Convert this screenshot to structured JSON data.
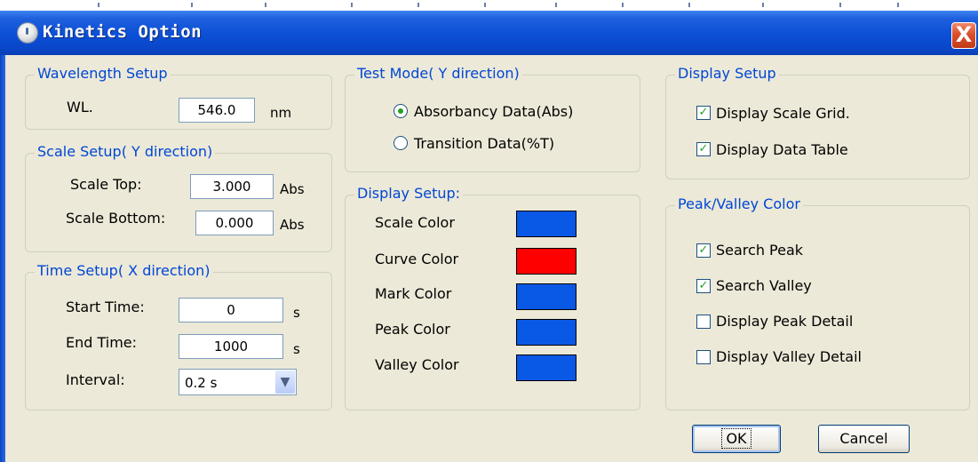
{
  "window": {
    "title": "Kinetics Option",
    "close_label": "X"
  },
  "wavelength_setup": {
    "legend": "Wavelength Setup",
    "label": "WL.",
    "value": "546.0",
    "unit": "nm"
  },
  "scale_setup": {
    "legend": "Scale Setup( Y direction)",
    "top_label": "Scale Top:",
    "top_value": "3.000",
    "top_unit": "Abs",
    "bottom_label": "Scale Bottom:",
    "bottom_value": "0.000",
    "bottom_unit": "Abs"
  },
  "time_setup": {
    "legend": "Time Setup( X direction)",
    "start_label": "Start Time:",
    "start_value": "0",
    "start_unit": "s",
    "end_label": "End Time:",
    "end_value": "1000",
    "end_unit": "s",
    "interval_label": "Interval:",
    "interval_value": "0.2 s"
  },
  "test_mode": {
    "legend": "Test Mode( Y direction)",
    "options": [
      {
        "label": "Absorbancy Data(Abs)",
        "selected": true
      },
      {
        "label": "Transition Data(%T)",
        "selected": false
      }
    ]
  },
  "display_colors": {
    "legend": "Display Setup:",
    "items": [
      {
        "label": "Scale Color",
        "color": "#0a58e6"
      },
      {
        "label": "Curve Color",
        "color": "#ff0000"
      },
      {
        "label": "Mark Color",
        "color": "#0a58e6"
      },
      {
        "label": "Peak Color",
        "color": "#0a58e6"
      },
      {
        "label": "Valley Color",
        "color": "#0a58e6"
      }
    ]
  },
  "display_setup": {
    "legend": "Display Setup",
    "items": [
      {
        "label": "Display Scale Grid.",
        "checked": true
      },
      {
        "label": "Display Data Table",
        "checked": true
      }
    ]
  },
  "peak_valley": {
    "legend": "Peak/Valley Color",
    "items": [
      {
        "label": "Search Peak",
        "checked": true
      },
      {
        "label": "Search Valley",
        "checked": true
      },
      {
        "label": "Display Peak Detail",
        "checked": false
      },
      {
        "label": "Display Valley Detail",
        "checked": false
      }
    ]
  },
  "buttons": {
    "ok": "OK",
    "cancel": "Cancel"
  }
}
